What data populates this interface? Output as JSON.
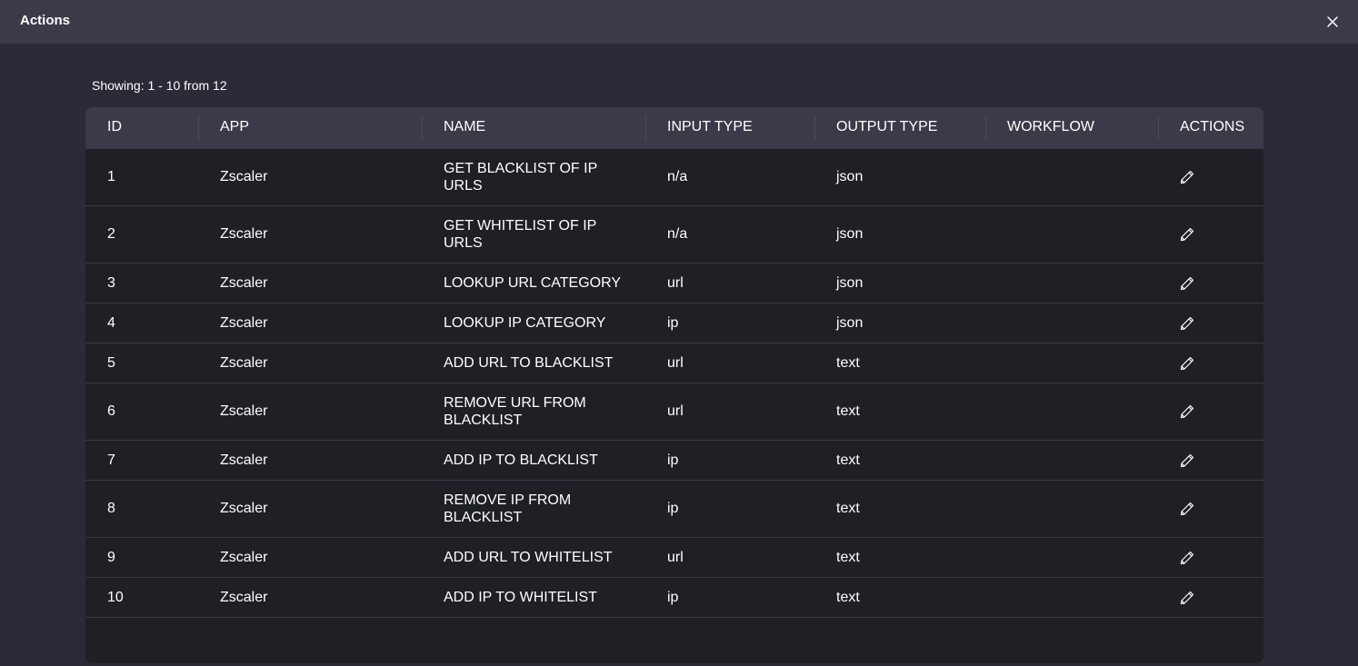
{
  "dialog": {
    "title": "Actions"
  },
  "pagination": {
    "showing_text": "Showing: 1 - 10 from 12"
  },
  "table": {
    "columns": [
      "ID",
      "APP",
      "NAME",
      "INPUT TYPE",
      "OUTPUT TYPE",
      "WORKFLOW",
      "ACTIONS"
    ],
    "rows": [
      {
        "id": "1",
        "app": "Zscaler",
        "name": "GET BLACKLIST OF IP URLS",
        "input": "n/a",
        "output": "json",
        "workflow": ""
      },
      {
        "id": "2",
        "app": "Zscaler",
        "name": "GET WHITELIST OF IP URLS",
        "input": "n/a",
        "output": "json",
        "workflow": ""
      },
      {
        "id": "3",
        "app": "Zscaler",
        "name": "LOOKUP URL CATEGORY",
        "input": "url",
        "output": "json",
        "workflow": ""
      },
      {
        "id": "4",
        "app": "Zscaler",
        "name": "LOOKUP IP CATEGORY",
        "input": "ip",
        "output": "json",
        "workflow": ""
      },
      {
        "id": "5",
        "app": "Zscaler",
        "name": "ADD URL TO BLACKLIST",
        "input": "url",
        "output": "text",
        "workflow": ""
      },
      {
        "id": "6",
        "app": "Zscaler",
        "name": "REMOVE URL FROM BLACKLIST",
        "input": "url",
        "output": "text",
        "workflow": ""
      },
      {
        "id": "7",
        "app": "Zscaler",
        "name": "ADD IP TO BLACKLIST",
        "input": "ip",
        "output": "text",
        "workflow": ""
      },
      {
        "id": "8",
        "app": "Zscaler",
        "name": "REMOVE IP FROM BLACKLIST",
        "input": "ip",
        "output": "text",
        "workflow": ""
      },
      {
        "id": "9",
        "app": "Zscaler",
        "name": "ADD URL TO WHITELIST",
        "input": "url",
        "output": "text",
        "workflow": ""
      },
      {
        "id": "10",
        "app": "Zscaler",
        "name": "ADD IP TO WHITELIST",
        "input": "ip",
        "output": "text",
        "workflow": ""
      }
    ]
  },
  "icons": {
    "close": "close-icon",
    "edit": "pencil-icon"
  },
  "colors": {
    "background": "#2b2b37",
    "titlebar": "#3a3a49",
    "table_body": "#1f1f26",
    "header": "#3a3a49"
  }
}
